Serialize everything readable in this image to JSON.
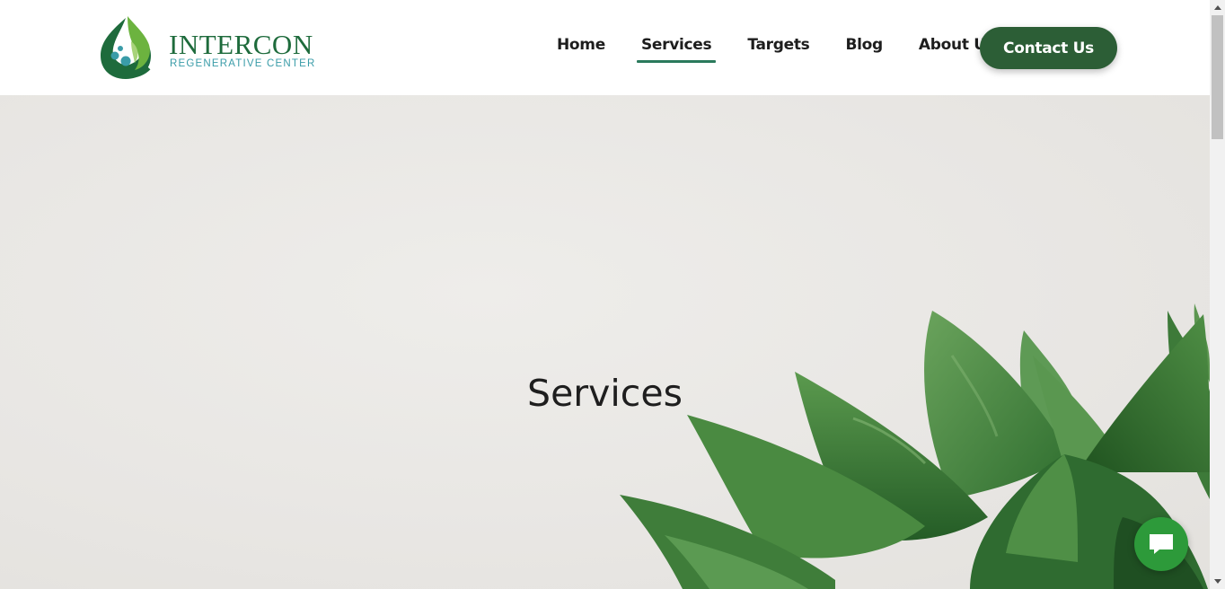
{
  "header": {
    "logo": {
      "name": "INTERCON",
      "subtitle": "REGENERATIVE CENTER"
    },
    "nav": [
      {
        "label": "Home",
        "active": false
      },
      {
        "label": "Services",
        "active": true
      },
      {
        "label": "Targets",
        "active": false
      },
      {
        "label": "Blog",
        "active": false
      },
      {
        "label": "About Us",
        "active": false
      }
    ],
    "contact_button": "Contact Us"
  },
  "hero": {
    "title": "Services"
  },
  "icons": {
    "logo": "leaf-drop-logo-icon",
    "chat": "chat-bubble-icon",
    "scroll_up": "arrow-up-icon",
    "scroll_down": "arrow-down-icon"
  },
  "colors": {
    "brand_green": "#2c5e36",
    "logo_green": "#1e6b3c",
    "logo_teal": "#3a9ca8",
    "nav_underline": "#2a7a5c",
    "chat_green": "#2d9a3a",
    "hero_background": "#e9e7e4",
    "plant_green": "#3f8a3e"
  }
}
